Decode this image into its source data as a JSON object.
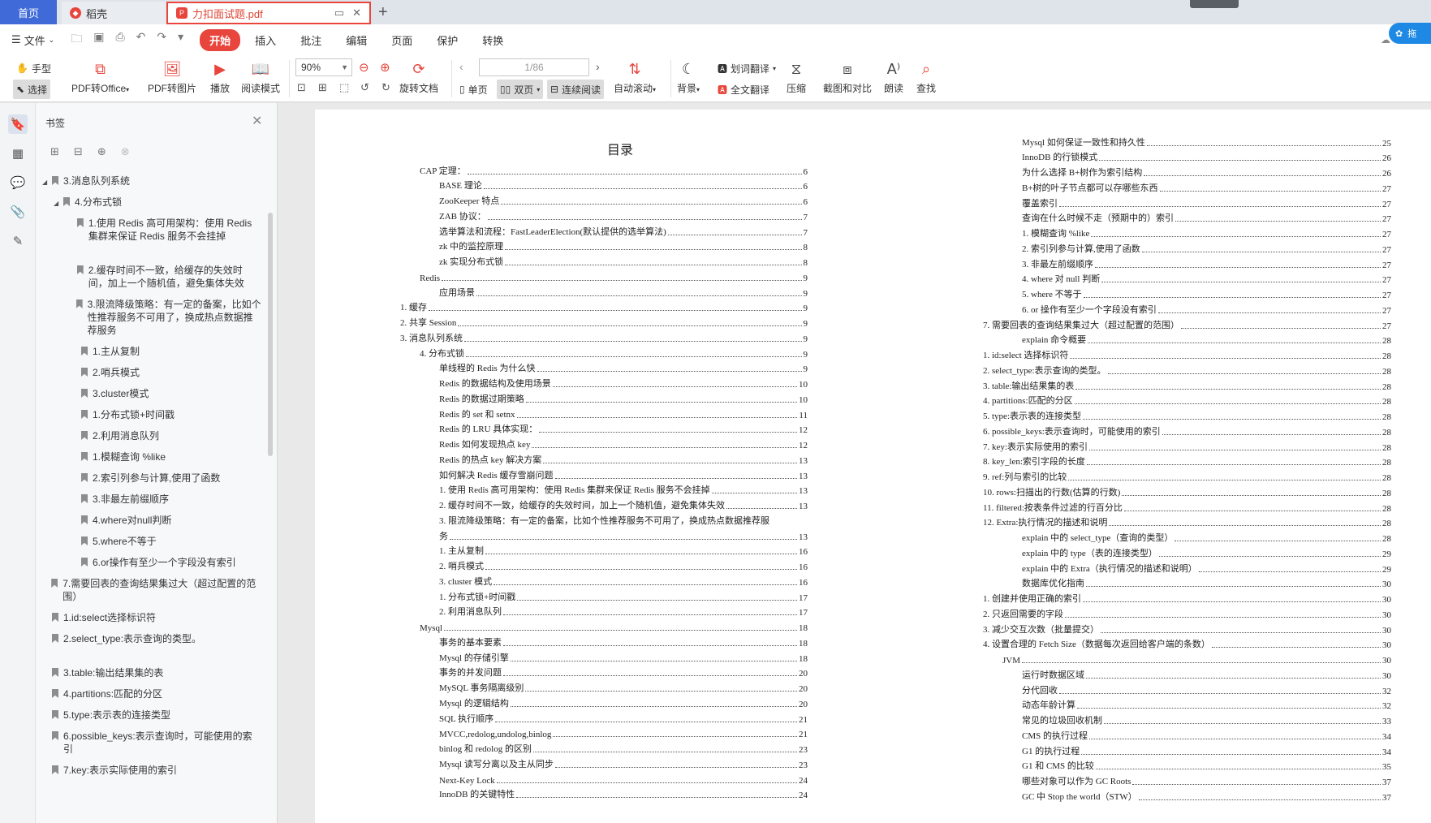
{
  "tabs": {
    "home": "首页",
    "daoke": "稻壳",
    "file": "力扣面试题.pdf",
    "file_icon_letter": "P"
  },
  "menu": {
    "file": "文件",
    "tabs": [
      "开始",
      "插入",
      "批注",
      "编辑",
      "页面",
      "保护",
      "转换"
    ],
    "active_tab": "开始",
    "side_label": "拖"
  },
  "toolbar": {
    "hand": "手型",
    "select": "选择",
    "pdf_to_office": "PDF转Office",
    "pdf_to_image": "PDF转图片",
    "play": "播放",
    "read_mode": "阅读模式",
    "zoom": "90%",
    "rotate_doc": "旋转文档",
    "page_indicator": "1/86",
    "single_page": "单页",
    "double_page": "双页",
    "continuous": "连续阅读",
    "auto_scroll": "自动滚动",
    "background": "背景",
    "word_translate": "划词翻译",
    "full_translate": "全文翻译",
    "compress": "压缩",
    "screenshot_compare": "截图和对比",
    "read_aloud": "朗读",
    "find": "查找"
  },
  "bookmarks": {
    "title": "书签",
    "items": [
      {
        "level": 1,
        "arrow": true,
        "text": "3.消息队列系统"
      },
      {
        "level": 2,
        "arrow": true,
        "text": "4.分布式锁"
      },
      {
        "level": 3,
        "text": "1.使用 Redis 高可用架构：使用 Redis 集群来保证 Redis 服务不会挂掉"
      },
      {
        "level": 3,
        "text": "2.缓存时间不一致，给缓存的失效时间，加上一个随机值，避免集体失效"
      },
      {
        "level": 3,
        "text": "3.限流降级策略：有一定的备案，比如个性推荐服务不可用了，换成热点数据推荐服务"
      },
      {
        "level": 3,
        "text": "1.主从复制"
      },
      {
        "level": 3,
        "text": "2.哨兵模式"
      },
      {
        "level": 3,
        "text": "3.cluster模式"
      },
      {
        "level": 3,
        "text": "1.分布式锁+时间戳"
      },
      {
        "level": 3,
        "text": "2.利用消息队列"
      },
      {
        "level": 3,
        "text": "1.模糊查询 %like"
      },
      {
        "level": 3,
        "text": "2.索引列参与计算,使用了函数"
      },
      {
        "level": 3,
        "text": "3.非最左前缀顺序"
      },
      {
        "level": 3,
        "text": "4.where对null判断"
      },
      {
        "level": 3,
        "text": "5.where不等于"
      },
      {
        "level": 3,
        "text": "6.or操作有至少一个字段没有索引"
      },
      {
        "level": 1,
        "text": "7.需要回表的查询结果集过大（超过配置的范围）"
      },
      {
        "level": 1,
        "text": "1.id:select选择标识符"
      },
      {
        "level": 1,
        "text": "2.select_type:表示查询的类型。"
      },
      {
        "level": 1,
        "text": "3.table:输出结果集的表"
      },
      {
        "level": 1,
        "text": "4.partitions:匹配的分区"
      },
      {
        "level": 1,
        "text": "5.type:表示表的连接类型"
      },
      {
        "level": 1,
        "text": "6.possible_keys:表示查询时，可能使用的索引"
      },
      {
        "level": 1,
        "text": "7.key:表示实际使用的索引"
      }
    ]
  },
  "toc": {
    "title": "目录",
    "left": [
      {
        "indent": 1,
        "text": "CAP 定理：",
        "page": "6"
      },
      {
        "indent": 2,
        "text": "BASE 理论",
        "page": "6"
      },
      {
        "indent": 2,
        "text": "ZooKeeper 特点",
        "page": "6"
      },
      {
        "indent": 2,
        "text": "ZAB 协议：",
        "page": "7"
      },
      {
        "indent": 2,
        "text": "选举算法和流程：FastLeaderElection(默认提供的选举算法)",
        "page": "7"
      },
      {
        "indent": 2,
        "text": "zk 中的监控原理",
        "page": "8"
      },
      {
        "indent": 2,
        "text": "zk 实现分布式锁",
        "page": "8"
      },
      {
        "indent": 1,
        "text": "Redis",
        "page": "9"
      },
      {
        "indent": 2,
        "text": "应用场景",
        "page": "9"
      },
      {
        "indent": 0,
        "text": "1.  缓存",
        "page": "9"
      },
      {
        "indent": 0,
        "text": "2.  共享 Session",
        "page": "9"
      },
      {
        "indent": 0,
        "text": "3.  消息队列系统",
        "page": "9"
      },
      {
        "indent": 1,
        "text": "4.  分布式锁",
        "page": "9"
      },
      {
        "indent": 2,
        "text": "单线程的 Redis 为什么快",
        "page": "9"
      },
      {
        "indent": 2,
        "text": "Redis 的数据结构及使用场景",
        "page": "10"
      },
      {
        "indent": 2,
        "text": "Redis 的数据过期策略",
        "page": "10"
      },
      {
        "indent": 2,
        "text": "Redis 的 set 和 setnx",
        "page": "11"
      },
      {
        "indent": 2,
        "text": "Redis 的 LRU 具体实现：",
        "page": "12"
      },
      {
        "indent": 2,
        "text": "Redis 如何发现热点 key",
        "page": "12"
      },
      {
        "indent": 2,
        "text": "Redis 的热点 key 解决方案",
        "page": "13"
      },
      {
        "indent": 2,
        "text": "如何解决 Redis 缓存雪崩问题",
        "page": "13"
      },
      {
        "indent": 2,
        "text": "1.  使用 Redis 高可用架构：使用 Redis 集群来保证 Redis 服务不会挂掉",
        "page": "13"
      },
      {
        "indent": 2,
        "text": "2.  缓存时间不一致，给缓存的失效时间，加上一个随机值，避免集体失效",
        "page": "13"
      },
      {
        "indent": 2,
        "text": "3.  限流降级策略：有一定的备案，比如个性推荐服务不可用了，换成热点数据推荐服",
        "page": ""
      },
      {
        "indent": 2,
        "text": "务",
        "page": "13"
      },
      {
        "indent": 2,
        "text": "1.  主从复制",
        "page": "16"
      },
      {
        "indent": 2,
        "text": "2.  哨兵模式",
        "page": "16"
      },
      {
        "indent": 2,
        "text": "3.  cluster 模式",
        "page": "16"
      },
      {
        "indent": 2,
        "text": "1.  分布式锁+时间戳",
        "page": "17"
      },
      {
        "indent": 2,
        "text": "2.  利用消息队列",
        "page": "17"
      },
      {
        "indent": 1,
        "text": "Mysql",
        "page": "18"
      },
      {
        "indent": 2,
        "text": "事务的基本要素",
        "page": "18"
      },
      {
        "indent": 2,
        "text": "Mysql 的存储引擎",
        "page": "18"
      },
      {
        "indent": 2,
        "text": "事务的并发问题",
        "page": "20"
      },
      {
        "indent": 2,
        "text": "MySQL 事务隔离级别",
        "page": "20"
      },
      {
        "indent": 2,
        "text": "Mysql 的逻辑结构",
        "page": "20"
      },
      {
        "indent": 2,
        "text": "SQL 执行顺序",
        "page": "21"
      },
      {
        "indent": 2,
        "text": "MVCC,redolog,undolog,binlog",
        "page": "21"
      },
      {
        "indent": 2,
        "text": "binlog 和 redolog 的区别",
        "page": "23"
      },
      {
        "indent": 2,
        "text": "Mysql 读写分离以及主从同步",
        "page": "23"
      },
      {
        "indent": 2,
        "text": "Next-Key Lock",
        "page": "24"
      },
      {
        "indent": 2,
        "text": "InnoDB 的关键特性",
        "page": "24"
      }
    ],
    "right": [
      {
        "indent": 2,
        "text": "Mysql 如何保证一致性和持久性",
        "page": "25"
      },
      {
        "indent": 2,
        "text": "InnoDB 的行锁模式",
        "page": "26"
      },
      {
        "indent": 2,
        "text": "为什么选择 B+树作为索引结构",
        "page": "26"
      },
      {
        "indent": 2,
        "text": "B+树的叶子节点都可以存哪些东西",
        "page": "27"
      },
      {
        "indent": 2,
        "text": "覆盖索引",
        "page": "27"
      },
      {
        "indent": 2,
        "text": "查询在什么时候不走（预期中的）索引",
        "page": "27"
      },
      {
        "indent": 2,
        "text": "1.  模糊查询 %like",
        "page": "27"
      },
      {
        "indent": 2,
        "text": "2.  索引列参与计算,使用了函数",
        "page": "27"
      },
      {
        "indent": 2,
        "text": "3.  非最左前缀顺序",
        "page": "27"
      },
      {
        "indent": 2,
        "text": "4.  where 对 null 判断",
        "page": "27"
      },
      {
        "indent": 2,
        "text": "5.  where 不等于",
        "page": "27"
      },
      {
        "indent": 2,
        "text": "6.  or 操作有至少一个字段没有索引",
        "page": "27"
      },
      {
        "indent": 0,
        "text": "7.  需要回表的查询结果集过大（超过配置的范围）",
        "page": "27"
      },
      {
        "indent": 2,
        "text": "explain 命令概要",
        "page": "28"
      },
      {
        "indent": 0,
        "text": "1. id:select 选择标识符",
        "page": "28"
      },
      {
        "indent": 0,
        "text": "2. select_type:表示查询的类型。",
        "page": "28"
      },
      {
        "indent": 0,
        "text": "3. table:输出结果集的表",
        "page": "28"
      },
      {
        "indent": 0,
        "text": "4. partitions:匹配的分区",
        "page": "28"
      },
      {
        "indent": 0,
        "text": "5. type:表示表的连接类型",
        "page": "28"
      },
      {
        "indent": 0,
        "text": "6. possible_keys:表示查询时，可能使用的索引",
        "page": "28"
      },
      {
        "indent": 0,
        "text": "7. key:表示实际使用的索引",
        "page": "28"
      },
      {
        "indent": 0,
        "text": "8. key_len:索引字段的长度",
        "page": "28"
      },
      {
        "indent": 0,
        "text": "9. ref:列与索引的比较",
        "page": "28"
      },
      {
        "indent": 0,
        "text": "10. rows:扫描出的行数(估算的行数)",
        "page": "28"
      },
      {
        "indent": 0,
        "text": "11. filtered:按表条件过滤的行百分比",
        "page": "28"
      },
      {
        "indent": 0,
        "text": "12. Extra:执行情况的描述和说明",
        "page": "28"
      },
      {
        "indent": 2,
        "text": "explain 中的 select_type（查询的类型）",
        "page": "28"
      },
      {
        "indent": 2,
        "text": "explain 中的 type（表的连接类型）",
        "page": "29"
      },
      {
        "indent": 2,
        "text": "explain 中的 Extra（执行情况的描述和说明）",
        "page": "29"
      },
      {
        "indent": 2,
        "text": "数据库优化指南",
        "page": "30"
      },
      {
        "indent": 0,
        "text": "1.  创建并使用正确的索引",
        "page": "30"
      },
      {
        "indent": 0,
        "text": "2.  只返回需要的字段",
        "page": "30"
      },
      {
        "indent": 0,
        "text": "3.  减少交互次数（批量提交）",
        "page": "30"
      },
      {
        "indent": 0,
        "text": "4.  设置合理的 Fetch Size（数据每次返回给客户端的条数）",
        "page": "30"
      },
      {
        "indent": 1,
        "text": "JVM",
        "page": "30"
      },
      {
        "indent": 2,
        "text": "运行时数据区域",
        "page": "30"
      },
      {
        "indent": 2,
        "text": "分代回收",
        "page": "32"
      },
      {
        "indent": 2,
        "text": "动态年龄计算",
        "page": "32"
      },
      {
        "indent": 2,
        "text": "常见的垃圾回收机制",
        "page": "33"
      },
      {
        "indent": 2,
        "text": "CMS 的执行过程",
        "page": "34"
      },
      {
        "indent": 2,
        "text": "G1 的执行过程",
        "page": "34"
      },
      {
        "indent": 2,
        "text": "G1 和 CMS 的比较",
        "page": "35"
      },
      {
        "indent": 2,
        "text": "哪些对象可以作为 GC Roots",
        "page": "37"
      },
      {
        "indent": 2,
        "text": "GC 中 Stop the world（STW）",
        "page": "37"
      }
    ]
  },
  "colors": {
    "accent": "#e8453c",
    "home_tab": "#3f6ad8"
  }
}
